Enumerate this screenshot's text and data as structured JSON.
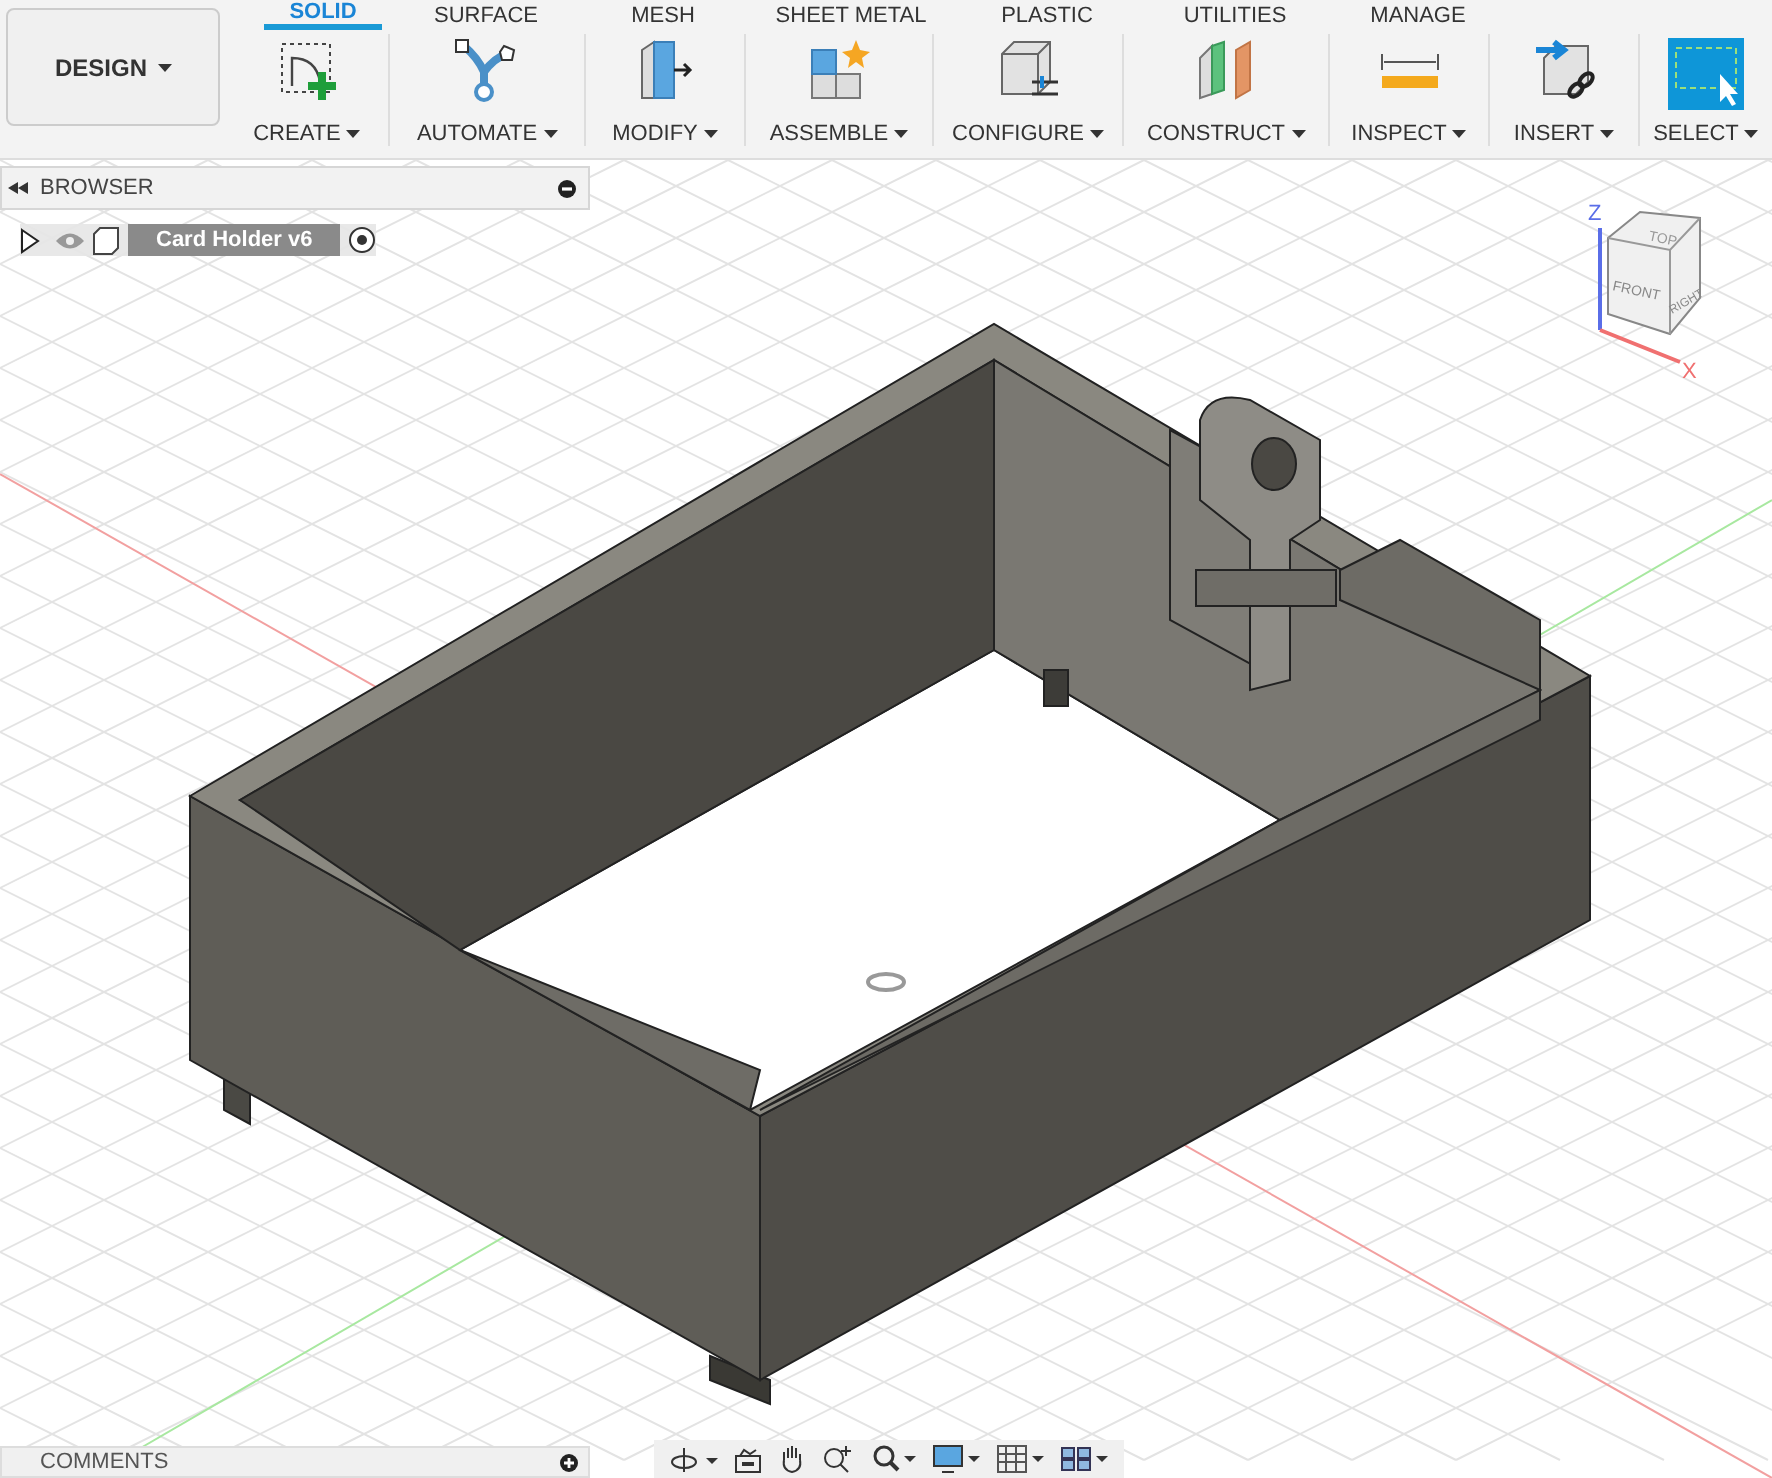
{
  "workspace_menu": {
    "label": "DESIGN"
  },
  "tabs": [
    {
      "label": "SOLID",
      "selected": true
    },
    {
      "label": "SURFACE",
      "selected": false
    },
    {
      "label": "MESH",
      "selected": false
    },
    {
      "label": "SHEET METAL",
      "selected": false
    },
    {
      "label": "PLASTIC",
      "selected": false
    },
    {
      "label": "UTILITIES",
      "selected": false
    },
    {
      "label": "MANAGE",
      "selected": false
    }
  ],
  "tool_groups": [
    {
      "label": "CREATE",
      "kind": "create"
    },
    {
      "label": "AUTOMATE",
      "kind": "automate"
    },
    {
      "label": "MODIFY",
      "kind": "modify"
    },
    {
      "label": "ASSEMBLE",
      "kind": "assemble"
    },
    {
      "label": "CONFIGURE",
      "kind": "configure"
    },
    {
      "label": "CONSTRUCT",
      "kind": "construct"
    },
    {
      "label": "INSPECT",
      "kind": "inspect"
    },
    {
      "label": "INSERT",
      "kind": "insert"
    },
    {
      "label": "SELECT",
      "kind": "select"
    }
  ],
  "browser": {
    "title": "BROWSER",
    "items": [
      {
        "name": "Card Holder v6",
        "expanded": false,
        "visible": true
      }
    ]
  },
  "view_cube": {
    "faces": [
      "TOP",
      "FRONT",
      "RIGHT"
    ],
    "axes": [
      "Z",
      "X"
    ]
  },
  "comments": {
    "title": "COMMENTS"
  }
}
